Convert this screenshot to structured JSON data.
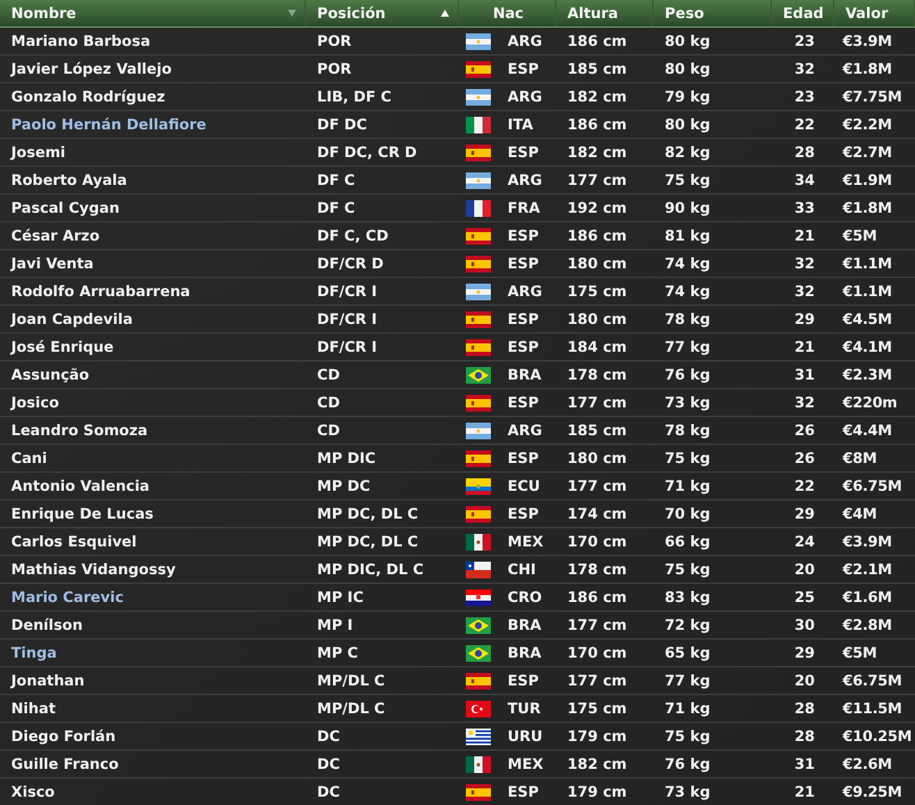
{
  "table": {
    "columns": [
      {
        "label": "Nombre",
        "sort": {
          "kind": "descending"
        }
      },
      {
        "label": "Posición",
        "sort": {
          "kind": "ascending"
        }
      },
      {
        "label": "Nac"
      },
      {
        "label": "Altura"
      },
      {
        "label": "Peso"
      },
      {
        "label": "Edad"
      },
      {
        "label": "Valor"
      }
    ],
    "rows": [
      {
        "name": "Mariano Barbosa",
        "highlighted": false,
        "position": "POR",
        "flag": {
          "kind": "argentina"
        },
        "nation": "ARG",
        "height": "186 cm",
        "weight": "80 kg",
        "age": "23",
        "value": "€3.9M"
      },
      {
        "name": "Javier López Vallejo",
        "highlighted": false,
        "position": "POR",
        "flag": {
          "kind": "spain"
        },
        "nation": "ESP",
        "height": "185 cm",
        "weight": "80 kg",
        "age": "32",
        "value": "€1.8M"
      },
      {
        "name": "Gonzalo Rodríguez",
        "highlighted": false,
        "position": "LIB, DF C",
        "flag": {
          "kind": "argentina"
        },
        "nation": "ARG",
        "height": "182 cm",
        "weight": "79 kg",
        "age": "23",
        "value": "€7.75M"
      },
      {
        "name": "Paolo Hernán Dellafiore",
        "highlighted": true,
        "position": "DF DC",
        "flag": {
          "kind": "italy"
        },
        "nation": "ITA",
        "height": "186 cm",
        "weight": "80 kg",
        "age": "22",
        "value": "€2.2M"
      },
      {
        "name": "Josemi",
        "highlighted": false,
        "position": "DF DC, CR D",
        "flag": {
          "kind": "spain"
        },
        "nation": "ESP",
        "height": "182 cm",
        "weight": "82 kg",
        "age": "28",
        "value": "€2.7M"
      },
      {
        "name": "Roberto Ayala",
        "highlighted": false,
        "position": "DF C",
        "flag": {
          "kind": "argentina"
        },
        "nation": "ARG",
        "height": "177 cm",
        "weight": "75 kg",
        "age": "34",
        "value": "€1.9M"
      },
      {
        "name": "Pascal Cygan",
        "highlighted": false,
        "position": "DF C",
        "flag": {
          "kind": "france"
        },
        "nation": "FRA",
        "height": "192 cm",
        "weight": "90 kg",
        "age": "33",
        "value": "€1.8M"
      },
      {
        "name": "César Arzo",
        "highlighted": false,
        "position": "DF C, CD",
        "flag": {
          "kind": "spain"
        },
        "nation": "ESP",
        "height": "186 cm",
        "weight": "81 kg",
        "age": "21",
        "value": "€5M"
      },
      {
        "name": "Javi Venta",
        "highlighted": false,
        "position": "DF/CR D",
        "flag": {
          "kind": "spain"
        },
        "nation": "ESP",
        "height": "180 cm",
        "weight": "74 kg",
        "age": "32",
        "value": "€1.1M"
      },
      {
        "name": "Rodolfo Arruabarrena",
        "highlighted": false,
        "position": "DF/CR I",
        "flag": {
          "kind": "argentina"
        },
        "nation": "ARG",
        "height": "175 cm",
        "weight": "74 kg",
        "age": "32",
        "value": "€1.1M"
      },
      {
        "name": "Joan Capdevila",
        "highlighted": false,
        "position": "DF/CR I",
        "flag": {
          "kind": "spain"
        },
        "nation": "ESP",
        "height": "180 cm",
        "weight": "78 kg",
        "age": "29",
        "value": "€4.5M"
      },
      {
        "name": "José Enrique",
        "highlighted": false,
        "position": "DF/CR I",
        "flag": {
          "kind": "spain"
        },
        "nation": "ESP",
        "height": "184 cm",
        "weight": "77 kg",
        "age": "21",
        "value": "€4.1M"
      },
      {
        "name": "Assunção",
        "highlighted": false,
        "position": "CD",
        "flag": {
          "kind": "brazil"
        },
        "nation": "BRA",
        "height": "178 cm",
        "weight": "76 kg",
        "age": "31",
        "value": "€2.3M"
      },
      {
        "name": "Josico",
        "highlighted": false,
        "position": "CD",
        "flag": {
          "kind": "spain"
        },
        "nation": "ESP",
        "height": "177 cm",
        "weight": "73 kg",
        "age": "32",
        "value": "€220m"
      },
      {
        "name": "Leandro Somoza",
        "highlighted": false,
        "position": "CD",
        "flag": {
          "kind": "argentina"
        },
        "nation": "ARG",
        "height": "185 cm",
        "weight": "78 kg",
        "age": "26",
        "value": "€4.4M"
      },
      {
        "name": "Cani",
        "highlighted": false,
        "position": "MP DIC",
        "flag": {
          "kind": "spain"
        },
        "nation": "ESP",
        "height": "180 cm",
        "weight": "75 kg",
        "age": "26",
        "value": "€8M"
      },
      {
        "name": "Antonio Valencia",
        "highlighted": false,
        "position": "MP DC",
        "flag": {
          "kind": "ecuador"
        },
        "nation": "ECU",
        "height": "177 cm",
        "weight": "71 kg",
        "age": "22",
        "value": "€6.75M"
      },
      {
        "name": "Enrique De Lucas",
        "highlighted": false,
        "position": "MP DC, DL C",
        "flag": {
          "kind": "spain"
        },
        "nation": "ESP",
        "height": "174 cm",
        "weight": "70 kg",
        "age": "29",
        "value": "€4M"
      },
      {
        "name": "Carlos Esquivel",
        "highlighted": false,
        "position": "MP DC, DL C",
        "flag": {
          "kind": "mexico"
        },
        "nation": "MEX",
        "height": "170 cm",
        "weight": "66 kg",
        "age": "24",
        "value": "€3.9M"
      },
      {
        "name": "Mathias Vidangossy",
        "highlighted": false,
        "position": "MP DIC, DL C",
        "flag": {
          "kind": "chile"
        },
        "nation": "CHI",
        "height": "178 cm",
        "weight": "75 kg",
        "age": "20",
        "value": "€2.1M"
      },
      {
        "name": "Mario Carevic",
        "highlighted": true,
        "position": "MP IC",
        "flag": {
          "kind": "croatia"
        },
        "nation": "CRO",
        "height": "186 cm",
        "weight": "83 kg",
        "age": "25",
        "value": "€1.6M"
      },
      {
        "name": "Denílson",
        "highlighted": false,
        "position": "MP I",
        "flag": {
          "kind": "brazil"
        },
        "nation": "BRA",
        "height": "177 cm",
        "weight": "72 kg",
        "age": "30",
        "value": "€2.8M"
      },
      {
        "name": "Tinga",
        "highlighted": true,
        "position": "MP C",
        "flag": {
          "kind": "brazil"
        },
        "nation": "BRA",
        "height": "170 cm",
        "weight": "65 kg",
        "age": "29",
        "value": "€5M"
      },
      {
        "name": "Jonathan",
        "highlighted": false,
        "position": "MP/DL C",
        "flag": {
          "kind": "spain"
        },
        "nation": "ESP",
        "height": "177 cm",
        "weight": "77 kg",
        "age": "20",
        "value": "€6.75M"
      },
      {
        "name": "Nihat",
        "highlighted": false,
        "position": "MP/DL C",
        "flag": {
          "kind": "turkey"
        },
        "nation": "TUR",
        "height": "175 cm",
        "weight": "71 kg",
        "age": "28",
        "value": "€11.5M"
      },
      {
        "name": "Diego Forlán",
        "highlighted": false,
        "position": "DC",
        "flag": {
          "kind": "uruguay"
        },
        "nation": "URU",
        "height": "179 cm",
        "weight": "75 kg",
        "age": "28",
        "value": "€10.25M"
      },
      {
        "name": "Guille Franco",
        "highlighted": false,
        "position": "DC",
        "flag": {
          "kind": "mexico"
        },
        "nation": "MEX",
        "height": "182 cm",
        "weight": "76 kg",
        "age": "31",
        "value": "€2.6M"
      },
      {
        "name": "Xisco",
        "highlighted": false,
        "position": "DC",
        "flag": {
          "kind": "spain"
        },
        "nation": "ESP",
        "height": "179 cm",
        "weight": "73 kg",
        "age": "21",
        "value": "€9.25M"
      }
    ]
  }
}
